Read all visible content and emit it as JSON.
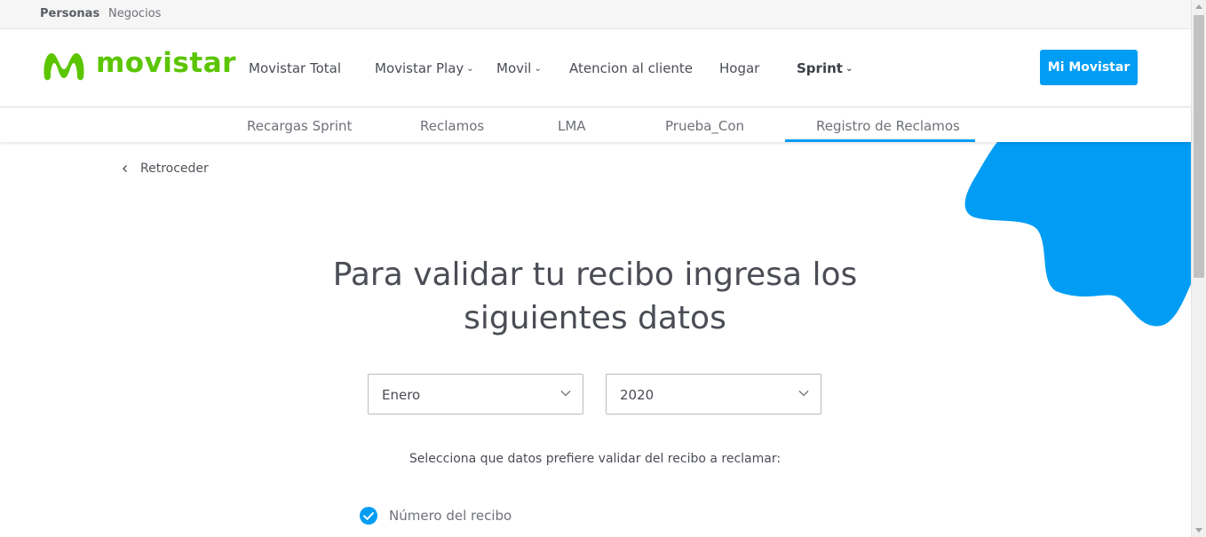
{
  "topbar": {
    "personas": "Personas",
    "negocios": "Negocios"
  },
  "header": {
    "logo_text": "movistar",
    "nav": [
      {
        "label": "Movistar Total",
        "dropdown": false,
        "bold": false
      },
      {
        "label": "Movistar Play",
        "dropdown": true,
        "bold": false
      },
      {
        "label": "Movil",
        "dropdown": true,
        "bold": false
      },
      {
        "label": "Atencion al cliente",
        "dropdown": false,
        "bold": false
      },
      {
        "label": "Hogar",
        "dropdown": false,
        "bold": false
      },
      {
        "label": "Sprint",
        "dropdown": true,
        "bold": true
      }
    ],
    "chevron": "⌄",
    "cta_label": "Mi Movistar"
  },
  "subnav": {
    "items": [
      "Recargas Sprint",
      "Reclamos",
      "LMA",
      "Prueba_Con",
      "Registro de Reclamos"
    ],
    "active": "Registro de Reclamos"
  },
  "back_label": "Retroceder",
  "title": "Para validar tu recibo ingresa los siguientes datos",
  "month_select": {
    "value": "Enero"
  },
  "year_select": {
    "value": "2020"
  },
  "instruction": "Selecciona que datos prefiere validar del recibo a reclamar:",
  "options": [
    {
      "label": "Número del recibo",
      "checked": true
    }
  ],
  "colors": {
    "brand_green": "#5bc500",
    "accent_blue": "#019df4",
    "text": "#4a4d55"
  },
  "icons": {
    "logo": "movistar-m-logo-icon",
    "back": "chevron-left-icon",
    "select_arrow": "chevron-down-icon",
    "check": "check-circle-icon"
  }
}
